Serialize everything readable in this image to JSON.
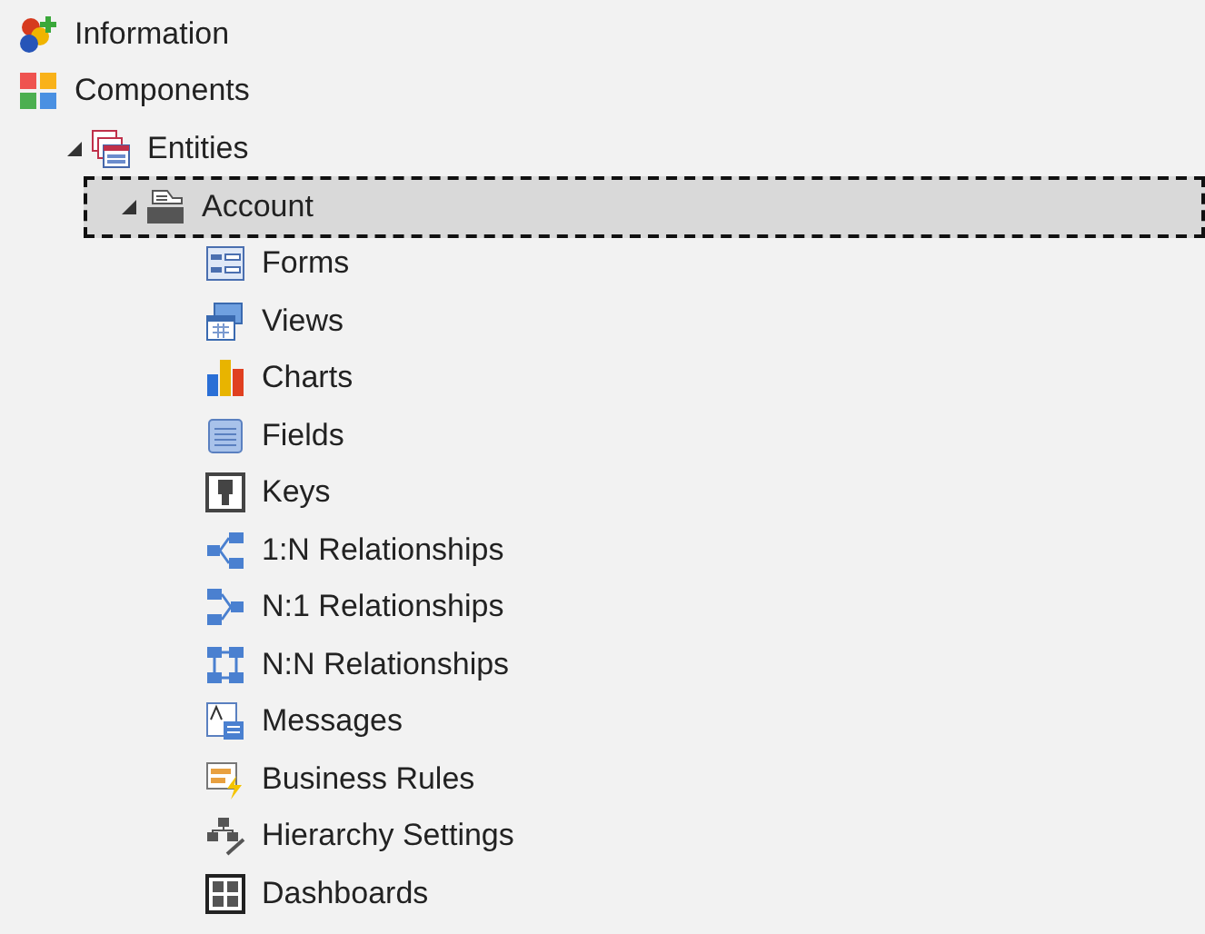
{
  "tree": [
    {
      "label": "Information",
      "selected": false
    },
    {
      "label": "Components",
      "selected": false,
      "children": [
        {
          "label": "Entities",
          "selected": false,
          "expanded": true,
          "children": [
            {
              "label": "Account",
              "selected": true,
              "expanded": true,
              "children": [
                {
                  "label": "Forms",
                  "selected": false
                },
                {
                  "label": "Views",
                  "selected": false
                },
                {
                  "label": "Charts",
                  "selected": false
                },
                {
                  "label": "Fields",
                  "selected": false
                },
                {
                  "label": "Keys",
                  "selected": false
                },
                {
                  "label": "1:N Relationships",
                  "selected": false
                },
                {
                  "label": "N:1 Relationships",
                  "selected": false
                },
                {
                  "label": "N:N Relationships",
                  "selected": false
                },
                {
                  "label": "Messages",
                  "selected": false
                },
                {
                  "label": "Business Rules",
                  "selected": false
                },
                {
                  "label": "Hierarchy Settings",
                  "selected": false
                },
                {
                  "label": "Dashboards",
                  "selected": false
                }
              ]
            }
          ]
        }
      ]
    }
  ]
}
